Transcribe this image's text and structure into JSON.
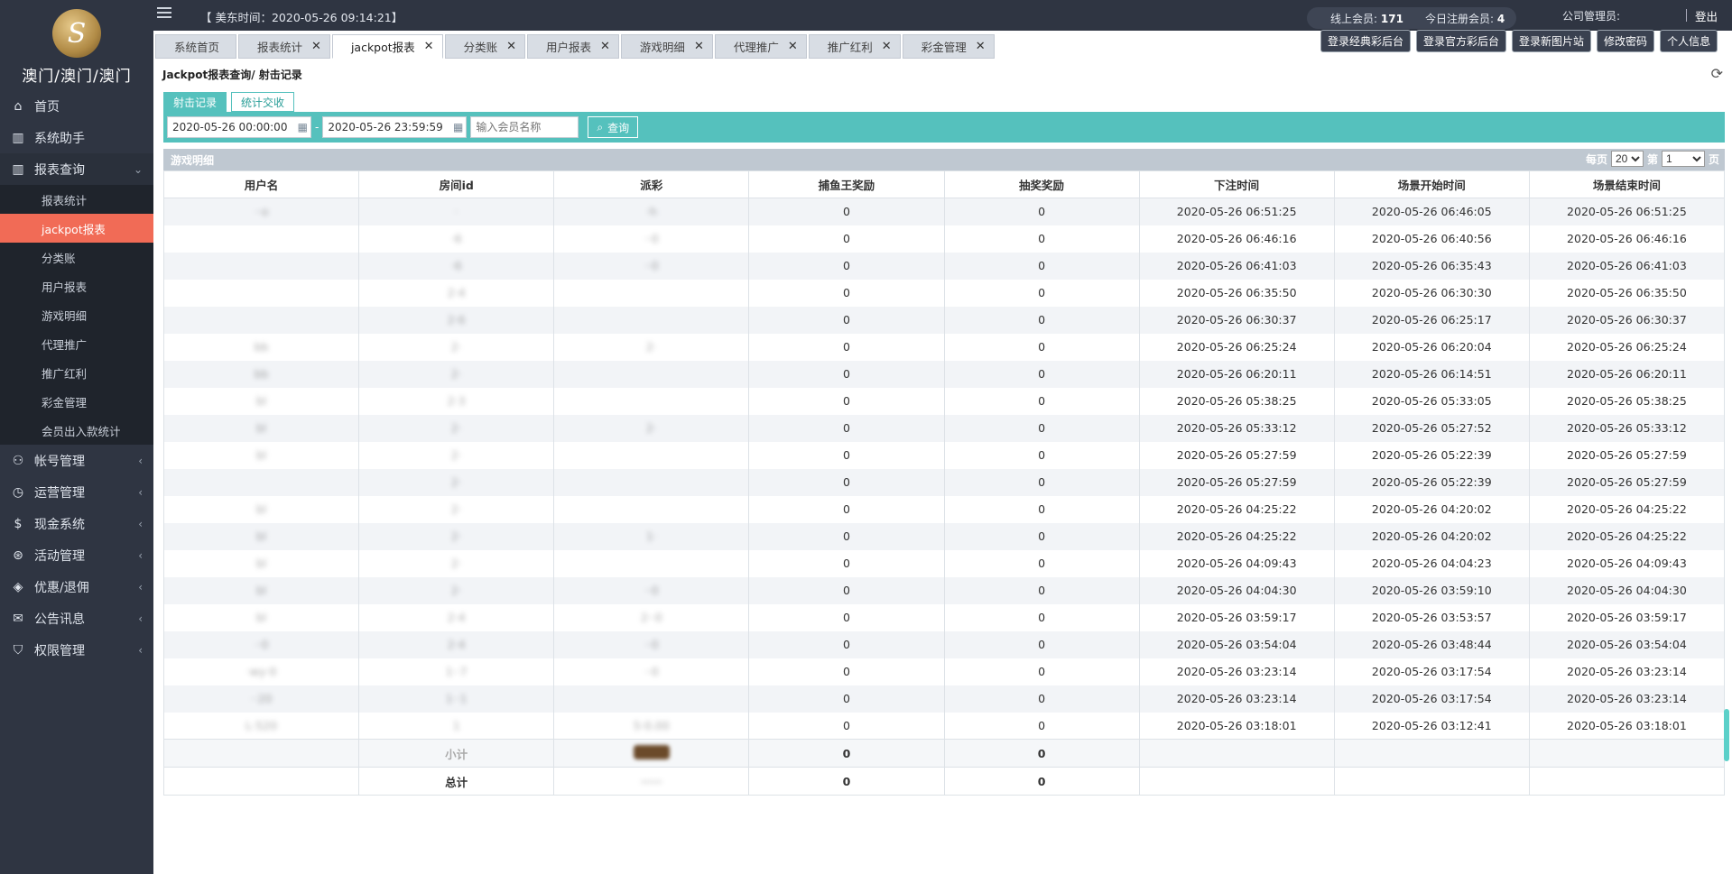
{
  "brand": {
    "name": "澳门/澳门/澳门",
    "logo_glyph": "S"
  },
  "topbar": {
    "time_label": "【 美东时间：2020-05-26 09:14:21】",
    "online_label": "线上会员:",
    "online_value": "171",
    "today_reg_label": "今日注册会员:",
    "today_reg_value": "4",
    "admin_label": "公司管理员:",
    "logout": "登出"
  },
  "top_buttons": [
    "登录经典彩后台",
    "登录官方彩后台",
    "登录新图片站",
    "修改密码",
    "个人信息"
  ],
  "tabs": [
    {
      "label": "系统首页",
      "closable": false
    },
    {
      "label": "报表统计",
      "closable": true
    },
    {
      "label": "jackpot报表",
      "closable": true,
      "active": true
    },
    {
      "label": "分类账",
      "closable": true
    },
    {
      "label": "用户报表",
      "closable": true
    },
    {
      "label": "游戏明细",
      "closable": true
    },
    {
      "label": "代理推广",
      "closable": true
    },
    {
      "label": "推广红利",
      "closable": true
    },
    {
      "label": "彩金管理",
      "closable": true
    }
  ],
  "sidebar": {
    "items": [
      {
        "label": "首页",
        "icon": "home-icon"
      },
      {
        "label": "系统助手",
        "icon": "building-icon"
      },
      {
        "label": "报表查询",
        "icon": "building-icon",
        "open": true
      }
    ],
    "sub_items": [
      "报表统计",
      "jackpot报表",
      "分类账",
      "用户报表",
      "游戏明细",
      "代理推广",
      "推广红利",
      "彩金管理",
      "会员出入款统计"
    ],
    "active_sub": "jackpot报表",
    "bottom_items": [
      {
        "label": "帐号管理",
        "icon": "user-icon"
      },
      {
        "label": "运营管理",
        "icon": "clock-icon"
      },
      {
        "label": "现金系统",
        "icon": "money-icon"
      },
      {
        "label": "活动管理",
        "icon": "gift-icon"
      },
      {
        "label": "优惠/退佣",
        "icon": "tag-icon"
      },
      {
        "label": "公告讯息",
        "icon": "mail-icon"
      },
      {
        "label": "权限管理",
        "icon": "shield-icon"
      }
    ]
  },
  "page": {
    "breadcrumb": "Jackpot报表查询/ 射击记录",
    "subtabs": [
      "射击记录",
      "统计交收"
    ],
    "filters": {
      "start": "2020-05-26 00:00:00",
      "end": "2020-05-26 23:59:59",
      "member_placeholder": "输入会员名称",
      "dash": "-",
      "query_label": "查询"
    },
    "grid_title": "游戏明细",
    "pager": {
      "per_page_label": "每页",
      "per_page": "20",
      "page_label": "第",
      "page": "1",
      "page_suffix": "页"
    }
  },
  "table": {
    "columns": [
      "用户名",
      "房间id",
      "派彩",
      "捕鱼王奖励",
      "抽奖奖励",
      "下注时间",
      "场景开始时间",
      "场景结束时间"
    ],
    "rows": [
      [
        "··o",
        "·",
        "·h",
        "0",
        "0",
        "2020-05-26 06:51:25",
        "2020-05-26 06:46:05",
        "2020-05-26 06:51:25"
      ],
      [
        "",
        "·6",
        "··0",
        "0",
        "0",
        "2020-05-26 06:46:16",
        "2020-05-26 06:40:56",
        "2020-05-26 06:46:16"
      ],
      [
        "",
        "·6",
        "··0",
        "0",
        "0",
        "2020-05-26 06:41:03",
        "2020-05-26 06:35:43",
        "2020-05-26 06:41:03"
      ],
      [
        "",
        "2·4",
        "",
        "0",
        "0",
        "2020-05-26 06:35:50",
        "2020-05-26 06:30:30",
        "2020-05-26 06:35:50"
      ],
      [
        "",
        "2·6",
        "",
        "0",
        "0",
        "2020-05-26 06:30:37",
        "2020-05-26 06:25:17",
        "2020-05-26 06:30:37"
      ],
      [
        "bb",
        "2·",
        "2·",
        "0",
        "0",
        "2020-05-26 06:25:24",
        "2020-05-26 06:20:04",
        "2020-05-26 06:25:24"
      ],
      [
        "bb",
        "2·",
        "",
        "0",
        "0",
        "2020-05-26 06:20:11",
        "2020-05-26 06:14:51",
        "2020-05-26 06:20:11"
      ],
      [
        "bl",
        "2·3",
        "",
        "0",
        "0",
        "2020-05-26 05:38:25",
        "2020-05-26 05:33:05",
        "2020-05-26 05:38:25"
      ],
      [
        "bl",
        "2·",
        "2·",
        "0",
        "0",
        "2020-05-26 05:33:12",
        "2020-05-26 05:27:52",
        "2020-05-26 05:33:12"
      ],
      [
        "bl",
        "2·",
        "",
        "0",
        "0",
        "2020-05-26 05:27:59",
        "2020-05-26 05:22:39",
        "2020-05-26 05:27:59"
      ],
      [
        "",
        "2·",
        "",
        "0",
        "0",
        "2020-05-26 05:27:59",
        "2020-05-26 05:22:39",
        "2020-05-26 05:27:59"
      ],
      [
        "bl",
        "2·",
        "",
        "0",
        "0",
        "2020-05-26 04:25:22",
        "2020-05-26 04:20:02",
        "2020-05-26 04:25:22"
      ],
      [
        "bl",
        "2·",
        "1·",
        "0",
        "0",
        "2020-05-26 04:25:22",
        "2020-05-26 04:20:02",
        "2020-05-26 04:25:22"
      ],
      [
        "bl",
        "2·",
        "",
        "0",
        "0",
        "2020-05-26 04:09:43",
        "2020-05-26 04:04:23",
        "2020-05-26 04:09:43"
      ],
      [
        "bl",
        "2·",
        "··0",
        "0",
        "0",
        "2020-05-26 04:04:30",
        "2020-05-26 03:59:10",
        "2020-05-26 04:04:30"
      ],
      [
        "bl",
        "2·4",
        "2··0",
        "0",
        "0",
        "2020-05-26 03:59:17",
        "2020-05-26 03:53:57",
        "2020-05-26 03:59:17"
      ],
      [
        "··0",
        "2·4",
        "··0",
        "0",
        "0",
        "2020-05-26 03:54:04",
        "2020-05-26 03:48:44",
        "2020-05-26 03:54:04"
      ],
      [
        "·wy·0",
        "1··7",
        "··0",
        "0",
        "0",
        "2020-05-26 03:23:14",
        "2020-05-26 03:17:54",
        "2020-05-26 03:23:14"
      ],
      [
        "··20",
        "1··1",
        "",
        "0",
        "0",
        "2020-05-26 03:23:14",
        "2020-05-26 03:17:54",
        "2020-05-26 03:23:14"
      ],
      [
        "L·520",
        "1",
        "5·0.00",
        "0",
        "0",
        "2020-05-26 03:18:01",
        "2020-05-26 03:12:41",
        "2020-05-26 03:18:01"
      ]
    ],
    "subtotal": {
      "label": "小计",
      "jackpot": "0",
      "lottery": "0"
    },
    "total": {
      "label": "总计",
      "jackpot": "0",
      "lottery": "0"
    }
  },
  "colors": {
    "accent": "#55c1bd",
    "active_nav": "#f16b56",
    "sidebar_bg": "#2f3542"
  }
}
